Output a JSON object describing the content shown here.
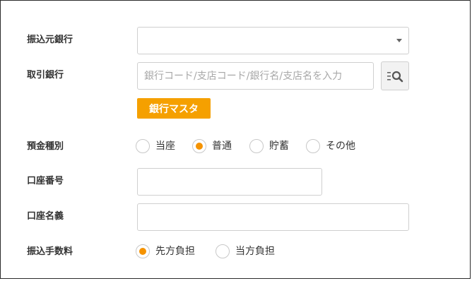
{
  "form": {
    "source_bank": {
      "label": "振込元銀行",
      "value": ""
    },
    "partner_bank": {
      "label": "取引銀行",
      "placeholder": "銀行コード/支店コード/銀行名/支店名を入力",
      "master_button": "銀行マスタ"
    },
    "deposit_type": {
      "label": "預金種別",
      "options": [
        {
          "label": "当座",
          "checked": false
        },
        {
          "label": "普通",
          "checked": true
        },
        {
          "label": "貯蓄",
          "checked": false
        },
        {
          "label": "その他",
          "checked": false
        }
      ]
    },
    "account_number": {
      "label": "口座番号",
      "value": ""
    },
    "account_name": {
      "label": "口座名義",
      "value": ""
    },
    "transfer_fee": {
      "label": "振込手数料",
      "options": [
        {
          "label": "先方負担",
          "checked": true
        },
        {
          "label": "当方負担",
          "checked": false
        }
      ]
    }
  },
  "colors": {
    "accent": "#f59300",
    "master_button_bg": "#f5a000",
    "border": "#cfcfcf",
    "placeholder": "#a8a8a8"
  },
  "icons": {
    "select_arrow": "chevron-down-icon",
    "bank_search": "list-search-icon"
  }
}
